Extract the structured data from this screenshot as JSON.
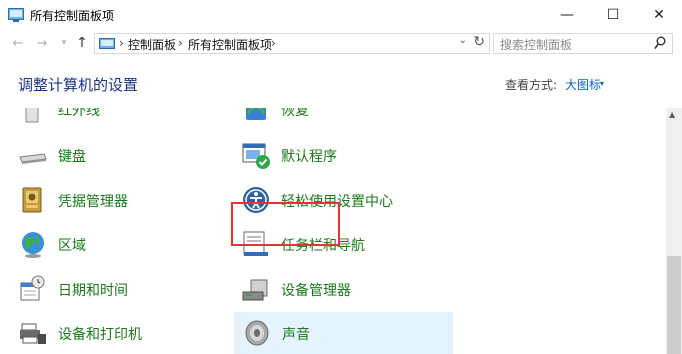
{
  "window": {
    "title": "所有控制面板项",
    "min_glyph": "—",
    "max_glyph": "☐",
    "close_glyph": "✕"
  },
  "nav": {
    "back_glyph": "←",
    "forward_glyph": "→",
    "recent_glyph": "▾",
    "up_glyph": "↑"
  },
  "address": {
    "sep1": "›",
    "crumb1": "控制面板",
    "sep2": "›",
    "crumb2": "所有控制面板项",
    "sep3": "›",
    "dropdown_glyph": "⌄",
    "refresh_glyph": "↻"
  },
  "search": {
    "placeholder": "搜索控制面板"
  },
  "header": {
    "title": "调整计算机的设置",
    "view_by_label": "查看方式:",
    "view_by_value": "大图标",
    "view_caret": "▾"
  },
  "items": {
    "infrared": "红外线",
    "recovery": "恢复",
    "keyboard": "键盘",
    "default_programs": "默认程序",
    "credential_manager": "凭据管理器",
    "ease_of_access": "轻松使用设置中心",
    "region": "区域",
    "taskbar_navigation": "任务栏和导航",
    "date_time": "日期和时间",
    "device_manager": "设备管理器",
    "devices_printers": "设备和打印机",
    "sound": "声音"
  },
  "colors": {
    "link_green": "#1a7a1a",
    "heading_blue": "#1e3287",
    "accent_blue": "#0066cc",
    "hover_bg": "#e5f3ff",
    "highlight_red": "#e23434"
  }
}
